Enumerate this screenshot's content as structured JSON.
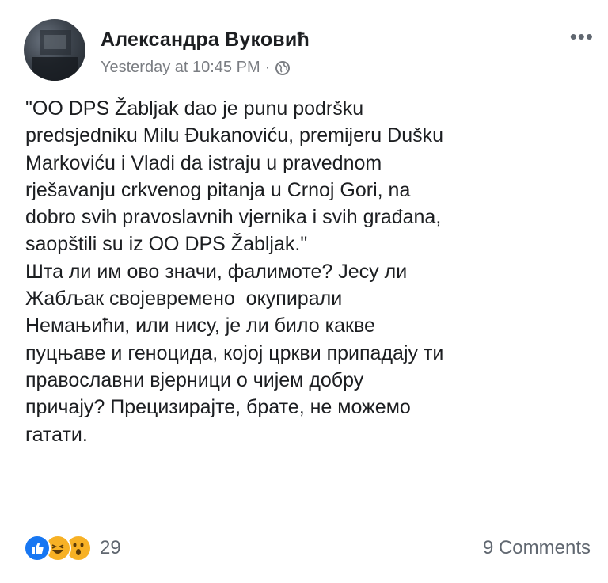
{
  "post": {
    "author": "Александра Вуковић",
    "timestamp": "Yesterday at 10:45 PM",
    "separator": "·",
    "privacy_icon": "globe-icon",
    "more_icon": "more-options-icon",
    "more_label": "•••",
    "text_lines": [
      "\"OO DPS Žabljak dao je punu podršku",
      "predsjedniku Milu Đukanoviću, premijeru Dušku",
      "Markoviću i Vladi da istraju u pravednom",
      "rješavanju crkvenog pitanja u Crnoj Gori, na",
      "dobro svih pravoslavnih vjernika i svih građana,",
      "saopštili su iz OO DPS Žabljak.\"",
      "Шта ли им ово значи, фалимоте? Јесу ли",
      "Жабљак својевремено  окупирали",
      "Немањићи, или нису, је ли било какве",
      "пуцњаве и геноцида, којој цркви припадају ти",
      "православни вјерници о чијем добру",
      "причају? Прецизирајте, брате, не можемо",
      "гатати."
    ]
  },
  "footer": {
    "reaction_icons": [
      "like-icon",
      "haha-icon",
      "wow-icon"
    ],
    "reaction_count": "29",
    "comments": "9 Comments"
  },
  "colors": {
    "like": "#1877f2",
    "haha": "#f7b125",
    "wow": "#f7b125",
    "text": "#1c1e21",
    "meta": "#7a7d82"
  }
}
